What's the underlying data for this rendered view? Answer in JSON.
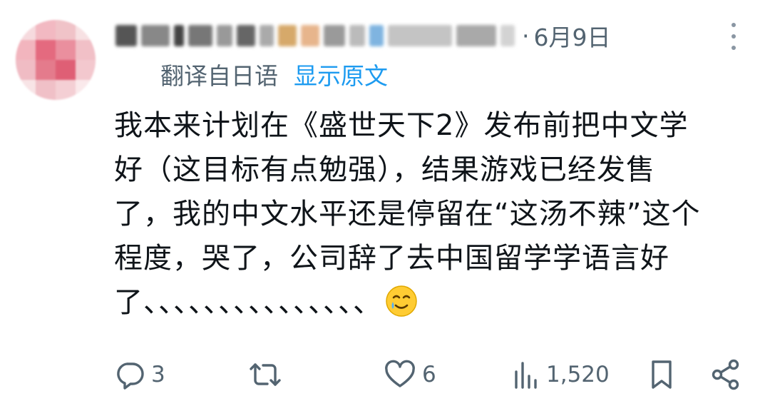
{
  "post": {
    "author_display": "",
    "date_separator": "·",
    "date": "6月9日",
    "translate_note": "翻译自日语",
    "show_original": "显示原文",
    "body_lines": [
      "我本来计划在《盛世天下2》发布前把中文学",
      "好（这目标有点勉强），结果游戏已经发售",
      "了，我的中文水平还是停留在“这汤不辣”这个",
      "程度，哭了，公司辞了去中国留学学语言好",
      "了、、、、、、、、、、、、、、、"
    ],
    "emoji": "smiling-face-with-tear-icon"
  },
  "actions": {
    "reply_count": "3",
    "repost_count": "",
    "like_count": "6",
    "view_count": "1,520"
  },
  "colors": {
    "text": "#0f1419",
    "secondary": "#536471",
    "link": "#1d9bf0"
  }
}
